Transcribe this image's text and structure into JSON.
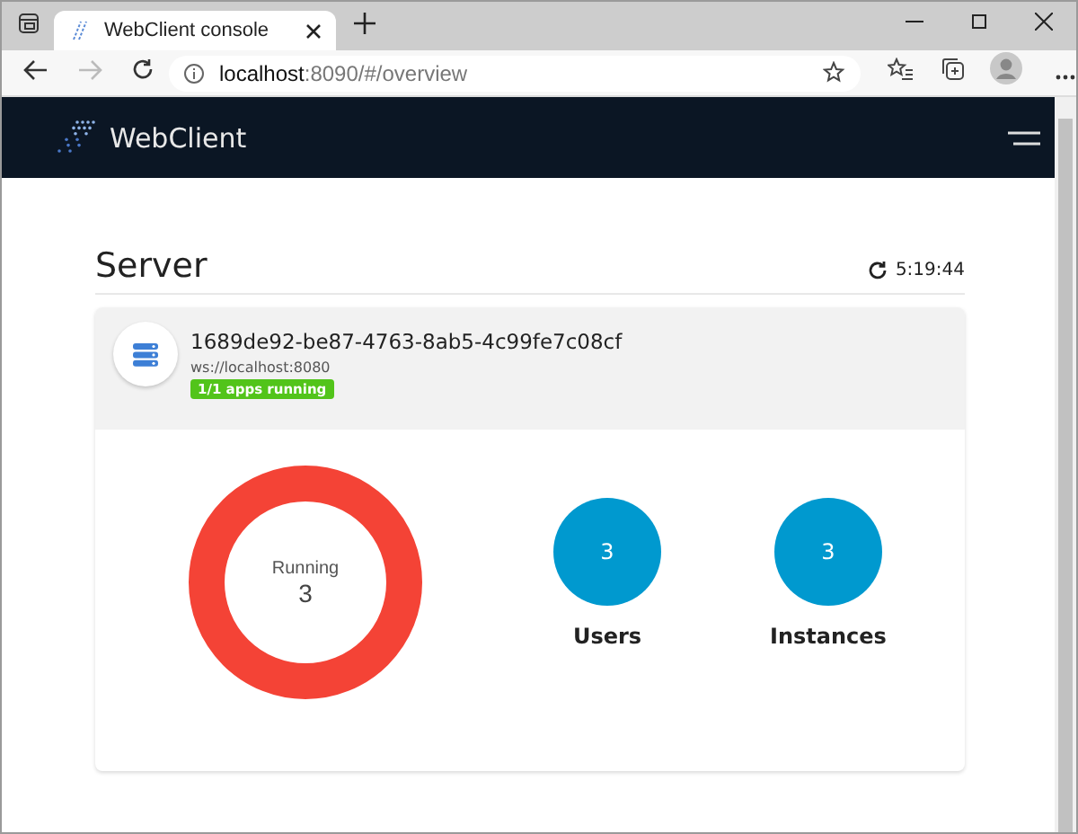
{
  "browser": {
    "tab_title": "WebClient console",
    "address": {
      "host": "localhost",
      "rest": ":8090/#/overview"
    }
  },
  "header": {
    "brand": "WebClient"
  },
  "page": {
    "title": "Server",
    "refresh_time": "5:19:44"
  },
  "server": {
    "id": "1689de92-be87-4763-8ab5-4c99fe7c08cf",
    "url": "ws://localhost:8080",
    "badge": "1/1 apps running"
  },
  "stats": [
    {
      "kind": "donut",
      "label": "Running",
      "value": "3",
      "color": "#f44336"
    },
    {
      "kind": "circle",
      "label": "Users",
      "value": "3",
      "color": "#0099cf"
    },
    {
      "kind": "circle",
      "label": "Instances",
      "value": "3",
      "color": "#0099cf"
    }
  ]
}
